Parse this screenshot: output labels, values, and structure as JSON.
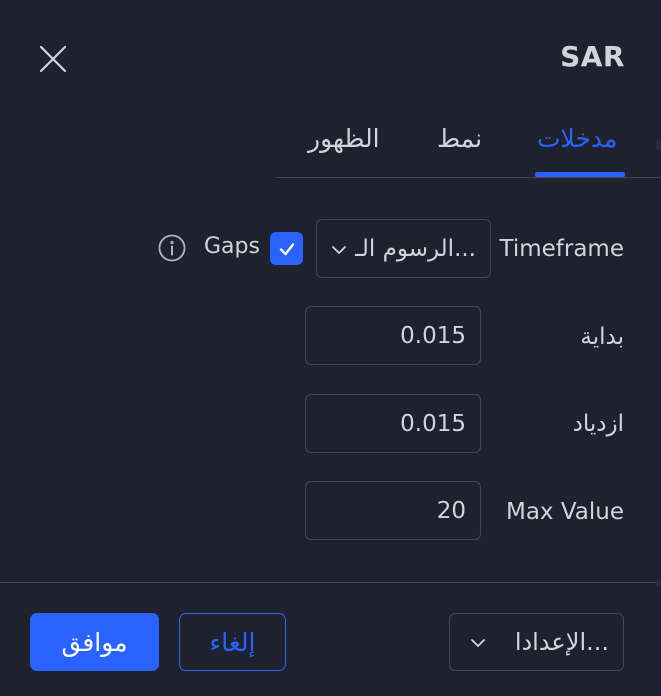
{
  "header": {
    "title": "SAR"
  },
  "tabs": [
    {
      "label": "مدخلات",
      "active": true
    },
    {
      "label": "نمط",
      "active": false
    },
    {
      "label": "الظهور",
      "active": false
    }
  ],
  "inputs": {
    "timeframe": {
      "label": "Timeframe",
      "value": "الرسوم الـ..."
    },
    "gaps": {
      "label": "Gaps",
      "checked": true
    },
    "start": {
      "label": "بداية",
      "value": "0.015"
    },
    "increment": {
      "label": "ازدياد",
      "value": "0.015"
    },
    "max_value": {
      "label": "Max Value",
      "value": "20"
    }
  },
  "footer": {
    "defaults_label": "الإعدادا...",
    "cancel_label": "إلغاء",
    "ok_label": "موافق"
  },
  "colors": {
    "background": "#1e222d",
    "accent": "#2962ff",
    "text": "#d1d4dc",
    "border": "#434651"
  },
  "icons": {
    "close": "close-icon",
    "chevron": "chevron-down-icon",
    "check": "checkmark-icon",
    "info": "info-icon"
  }
}
